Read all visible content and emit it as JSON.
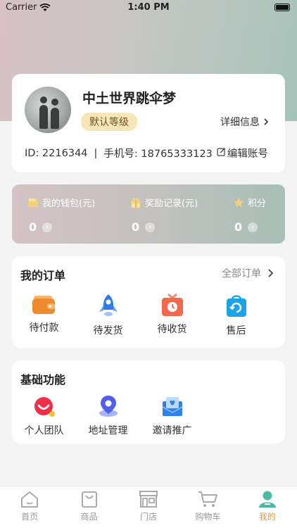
{
  "status_bar": {
    "carrier": "Carrier",
    "time": "1:40 PM"
  },
  "profile": {
    "username": "中土世界跳伞梦",
    "level": "默认等级",
    "detail_link": "详细信息",
    "id_text": "ID: 2216344",
    "separator": "|",
    "phone_text": "手机号: 18765333123",
    "edit_label": "编辑账号"
  },
  "wallet": {
    "items": [
      {
        "label": "我的钱包(元)",
        "value": "0",
        "icon": "wallet-icon"
      },
      {
        "label": "奖励记录(元)",
        "value": "0",
        "icon": "gift-icon"
      },
      {
        "label": "积分",
        "value": "0",
        "icon": "star-icon"
      }
    ]
  },
  "orders": {
    "title": "我的订单",
    "all_label": "全部订单",
    "items": [
      {
        "label": "待付款",
        "icon": "wallet-pay-icon"
      },
      {
        "label": "待发货",
        "icon": "rocket-icon"
      },
      {
        "label": "待收货",
        "icon": "package-clock-icon"
      },
      {
        "label": "售后",
        "icon": "bag-refresh-icon"
      }
    ]
  },
  "functions": {
    "title": "基础功能",
    "items": [
      {
        "label": "个人团队",
        "icon": "team-face-icon"
      },
      {
        "label": "地址管理",
        "icon": "location-icon"
      },
      {
        "label": "邀请推广",
        "icon": "mail-heart-icon"
      }
    ]
  },
  "tabbar": {
    "items": [
      {
        "label": "首页",
        "icon": "home-icon"
      },
      {
        "label": "商品",
        "icon": "shopping-bag-icon"
      },
      {
        "label": "门店",
        "icon": "store-icon"
      },
      {
        "label": "购物车",
        "icon": "cart-icon"
      },
      {
        "label": "我的",
        "icon": "user-icon",
        "active": true
      }
    ]
  },
  "colors": {
    "accent": "#e09a3e",
    "level_bg": "#f7e7b7",
    "order_blue": "#2f7be8",
    "order_orange": "#f08a2e"
  }
}
